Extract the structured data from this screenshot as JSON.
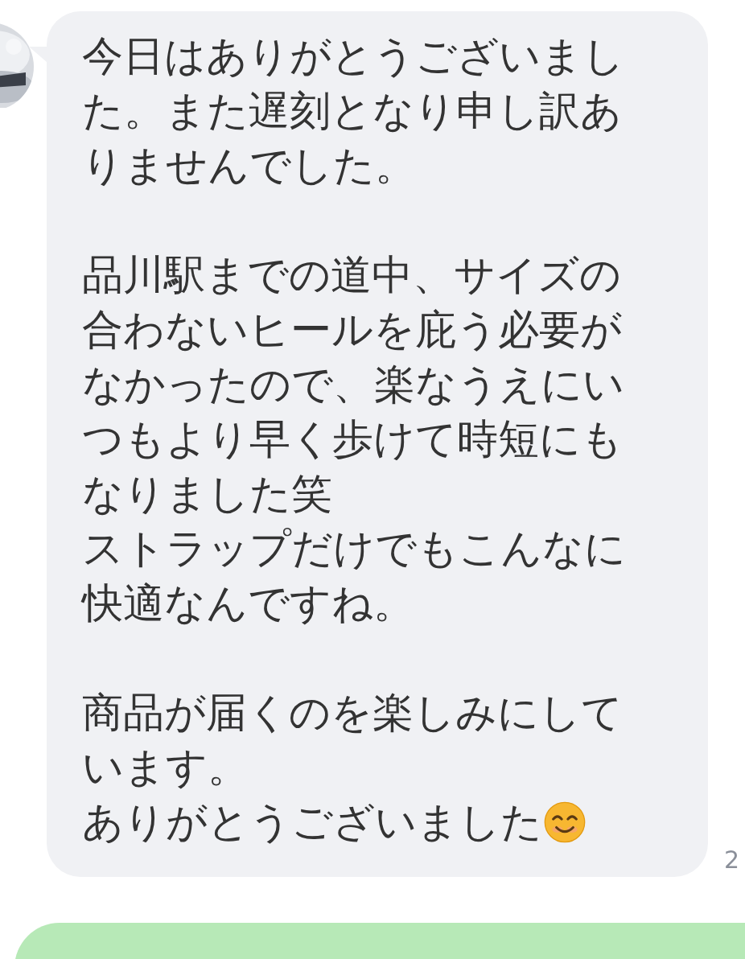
{
  "message": {
    "paragraphs": [
      [
        "今日はありがとうございました。また遅刻となり申し訳ありませんでした。"
      ],
      [
        "品川駅までの道中、サイズの合わないヒールを庇う必要がなかったので、楽なうえにいつもより早く歩けて時短にもなりました笑",
        "ストラップだけでもこんなに快適なんですね。"
      ],
      [
        "商品が届くのを楽しみにしています。",
        "ありがとうございました"
      ]
    ],
    "time": "2"
  }
}
